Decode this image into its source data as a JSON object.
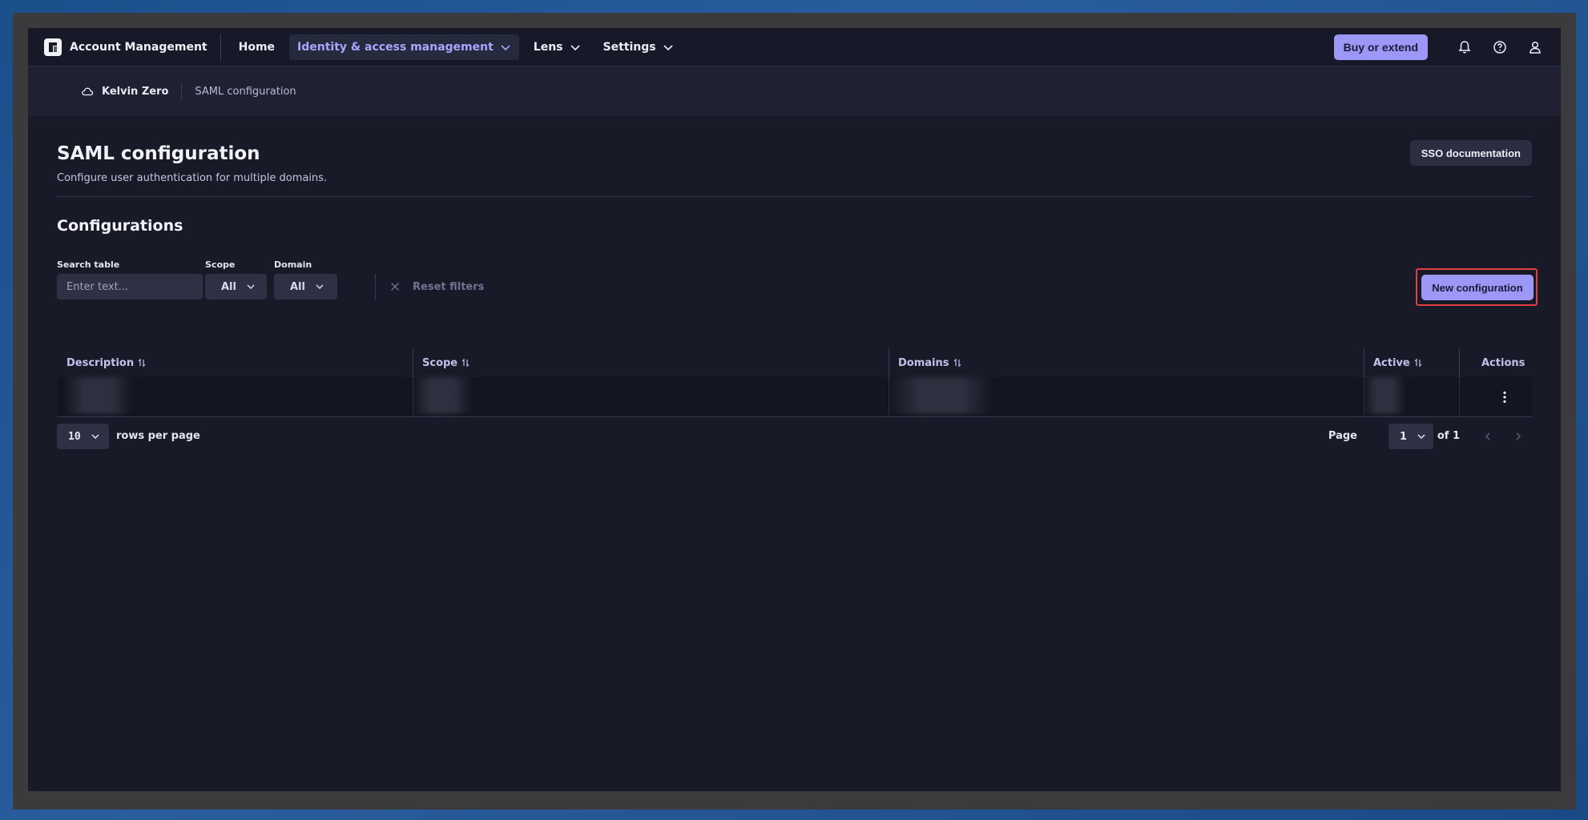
{
  "app": {
    "title": "Account Management"
  },
  "nav": {
    "items": [
      {
        "label": "Home",
        "active": false,
        "has_menu": false
      },
      {
        "label": "Identity & access management",
        "active": true,
        "has_menu": true
      },
      {
        "label": "Lens",
        "active": false,
        "has_menu": true
      },
      {
        "label": "Settings",
        "active": false,
        "has_menu": true
      }
    ],
    "buy_label": "Buy or extend",
    "icons": [
      "bell-icon",
      "help-icon",
      "user-icon"
    ]
  },
  "breadcrumb": {
    "environment": "Kelvin Zero",
    "current": "SAML configuration"
  },
  "page": {
    "title": "SAML configuration",
    "subtitle": "Configure user authentication for multiple domains.",
    "sso_label": "SSO documentation"
  },
  "configurations": {
    "title": "Configurations",
    "filters": {
      "search_label": "Search table",
      "search_placeholder": "Enter text...",
      "scope_label": "Scope",
      "scope_value": "All",
      "domain_label": "Domain",
      "domain_value": "All",
      "reset_label": "Reset filters"
    },
    "new_label": "New configuration",
    "table": {
      "columns": [
        "Description",
        "Scope",
        "Domains",
        "Active",
        "Actions"
      ],
      "rows_redacted": 1
    },
    "pagination": {
      "rows_per_page": "10",
      "rows_label": "rows per page",
      "page_label": "Page",
      "page_value": "1",
      "of_label": "of 1"
    }
  },
  "colors": {
    "accent": "#9d98f5",
    "highlight_border": "#e2403c",
    "background": "#181a27"
  }
}
